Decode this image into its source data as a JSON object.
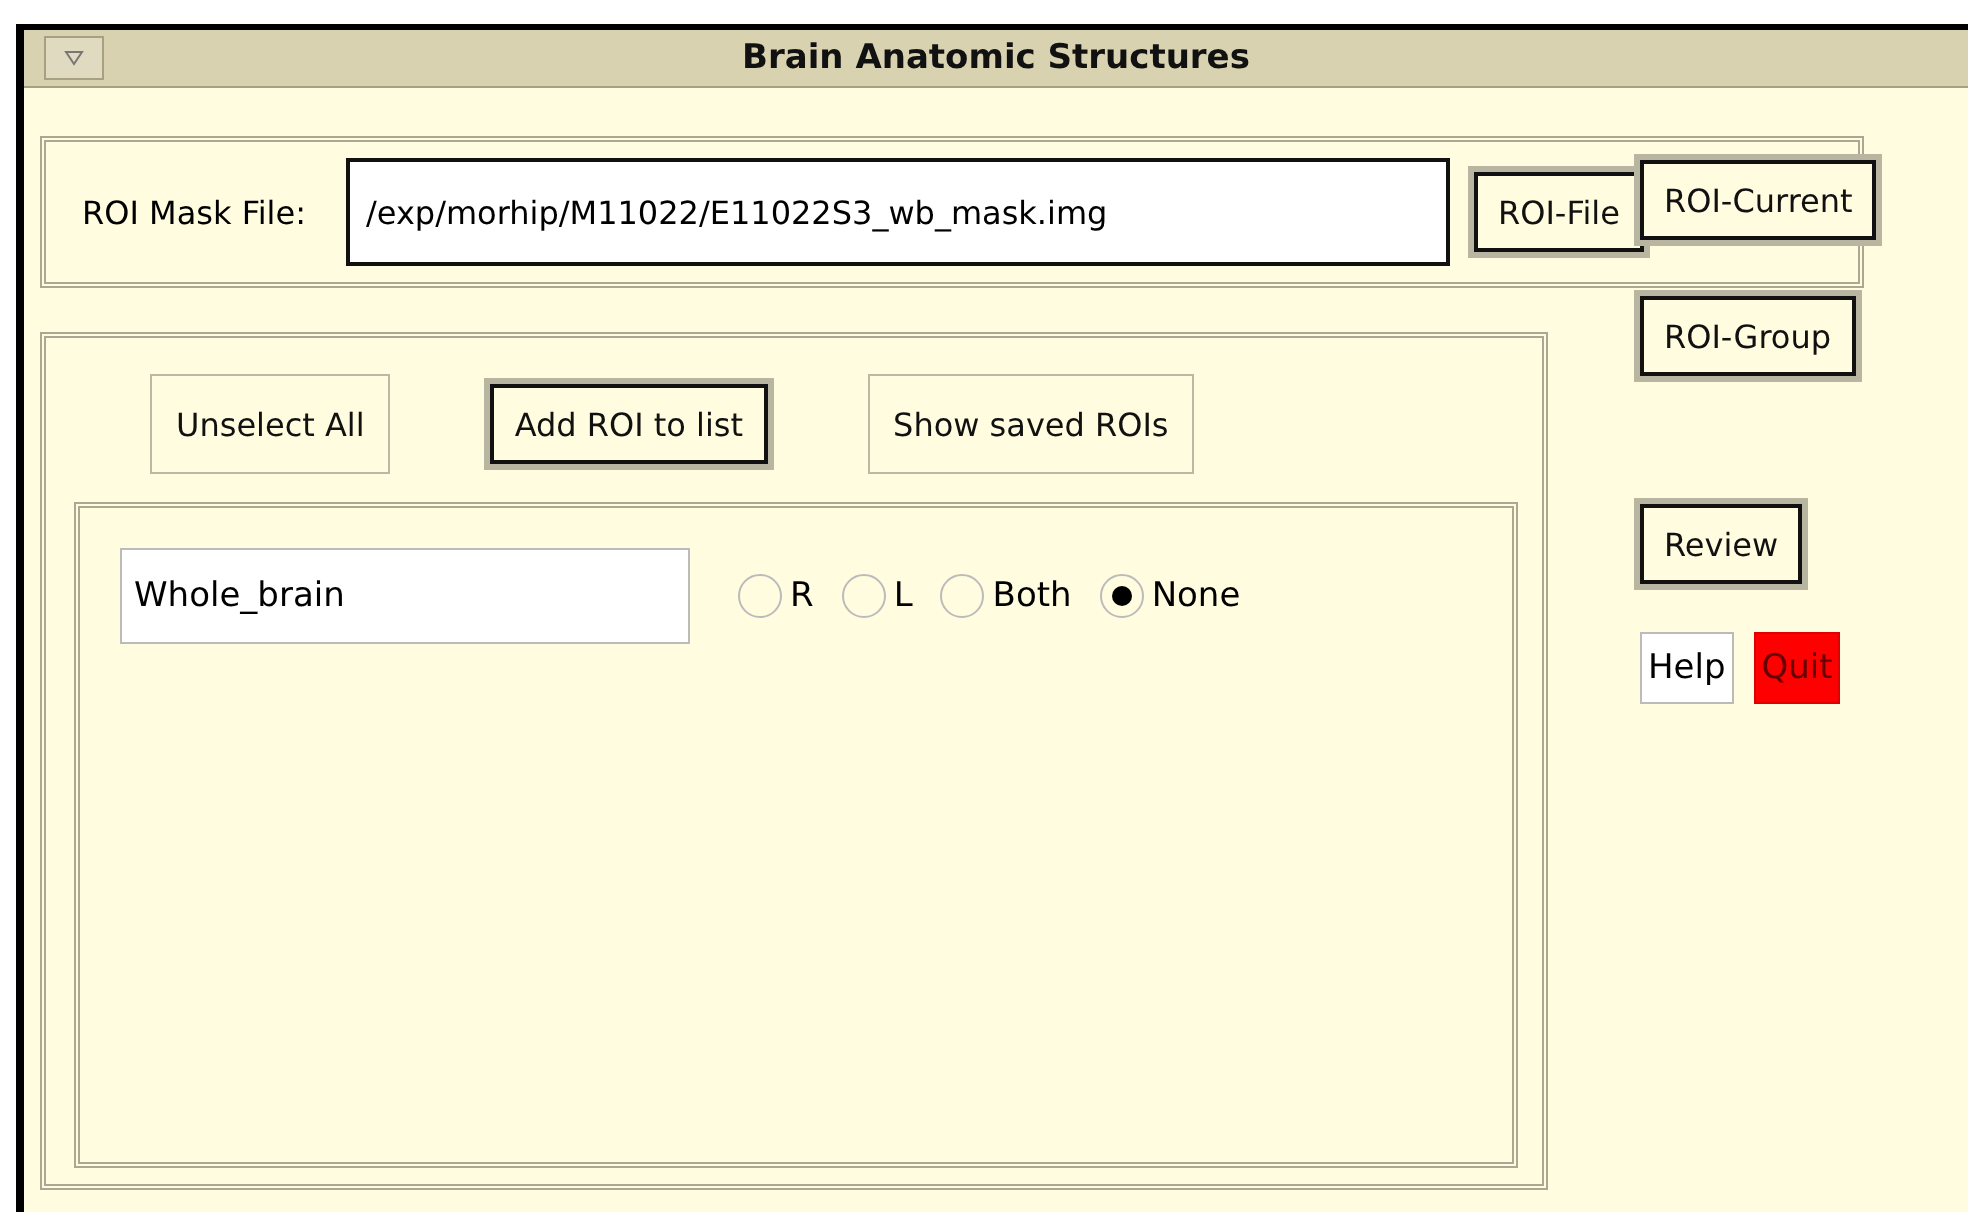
{
  "window": {
    "title": "Brain Anatomic Structures"
  },
  "mask_file": {
    "label": "ROI Mask File:",
    "value": "/exp/morhip/M11022/E11022S3_wb_mask.img",
    "button": {
      "label": "ROI-File",
      "kind": "default"
    }
  },
  "actions": [
    {
      "label": "Unselect All",
      "kind": "plain"
    },
    {
      "label": "Add ROI to list",
      "kind": "default"
    },
    {
      "label": "Show saved ROIs",
      "kind": "plain"
    }
  ],
  "roi": {
    "name": "Whole_brain",
    "sides": [
      {
        "label": "R",
        "selected": false
      },
      {
        "label": "L",
        "selected": false
      },
      {
        "label": "Both",
        "selected": false
      },
      {
        "label": "None",
        "selected": true
      }
    ]
  },
  "side_buttons": [
    {
      "label": "ROI-Current",
      "kind": "default"
    },
    {
      "label": "ROI-Group",
      "kind": "default"
    },
    {
      "label": "Review",
      "kind": "default"
    }
  ],
  "small_buttons": [
    {
      "label": "Help",
      "kind": "help"
    },
    {
      "label": "Quit",
      "kind": "quit"
    }
  ]
}
